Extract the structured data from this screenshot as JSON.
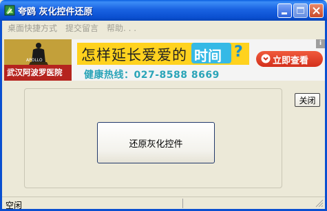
{
  "window": {
    "title": "夸鸥  灰化控件还原",
    "minimize_label": "",
    "maximize_label": "",
    "close_label": ""
  },
  "menu": {
    "items": [
      {
        "label": "桌面快捷方式"
      },
      {
        "label": "提交留言"
      },
      {
        "label": "帮助. . ."
      }
    ]
  },
  "banner": {
    "logo_text": "武汉阿波罗医院",
    "logo_small": "APOLLO",
    "headline": "怎样延长爱爱的",
    "headline_highlight": "时间",
    "headline_suffix": "?",
    "hotline": "健康热线：027-8588 8669",
    "cta_label": "立即查看",
    "corner_mark": "i",
    "colors": {
      "logo_gold": "#c3a03a",
      "logo_red": "#b5241f",
      "strip_yellow": "#ffd21e",
      "cta_red": "#e0412a",
      "hotline_teal": "#2aa4b8"
    }
  },
  "main": {
    "restore_button_label": "还原灰化控件",
    "close_button_label": "关闭"
  },
  "status": {
    "text": "空闲"
  },
  "icons": [
    "app-icon",
    "minimize-icon",
    "maximize-icon",
    "close-icon",
    "chevron-down-icon",
    "resize-grip-icon"
  ]
}
